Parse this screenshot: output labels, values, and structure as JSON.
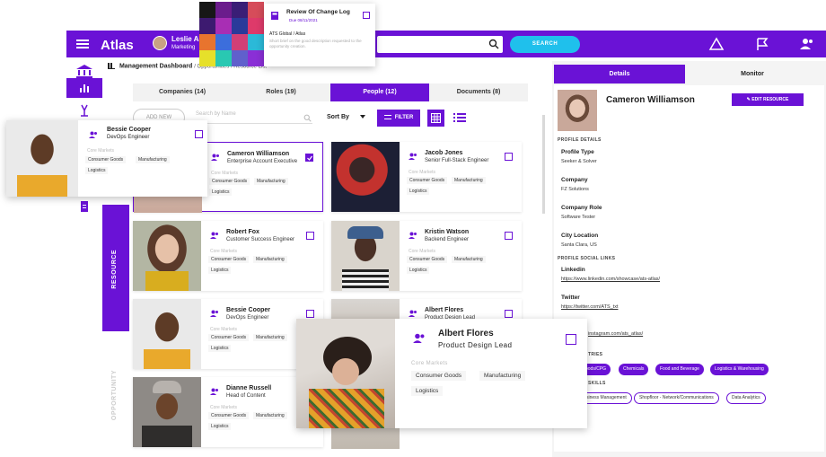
{
  "app": {
    "logo": "Atlas"
  },
  "user": {
    "name": "Leslie Ale",
    "role": "Marketing"
  },
  "search": {
    "button": "SEARCH"
  },
  "breadcrumb": {
    "title": "Management Dashboard",
    "rest": "/ Opportunities / Resource List"
  },
  "tabs": [
    {
      "label": "Companies (14)"
    },
    {
      "label": "Roles (19)"
    },
    {
      "label": "People (12)"
    },
    {
      "label": "Documents (8)"
    }
  ],
  "toolbar": {
    "add_new": "ADD NEW",
    "search_placeholder": "Search by Name",
    "sort_by": "Sort By",
    "filter": "FILTER"
  },
  "side_labels": {
    "resource": "RESOURCE",
    "opportunity": "OPPORTUNITY"
  },
  "core_markets_label": "Core Markets",
  "cards": [
    {
      "name": "Cameron Williamson",
      "title": "Enterprise Account Executive",
      "chips": [
        "Consumer Goods",
        "Manufacturing",
        "Logistics"
      ]
    },
    {
      "name": "Jacob Jones",
      "title": "Senior Full-Stack Engineer",
      "chips": [
        "Consumer Goods",
        "Manufacturing",
        "Logistics"
      ]
    },
    {
      "name": "Robert Fox",
      "title": "Customer Success Engineer",
      "chips": [
        "Consumer Goods",
        "Manufacturing",
        "Logistics"
      ]
    },
    {
      "name": "Kristin Watson",
      "title": "Backend Engineer",
      "chips": [
        "Consumer Goods",
        "Manufacturing",
        "Logistics"
      ]
    },
    {
      "name": "Bessie Cooper",
      "title": "DevOps Engineer",
      "chips": [
        "Consumer Goods",
        "Manufacturing",
        "Logistics"
      ]
    },
    {
      "name": "Albert Flores",
      "title": "Product Design Lead",
      "chips": [
        "Consumer Goods",
        "Manufacturing",
        "Logistics"
      ]
    },
    {
      "name": "Dianne Russell",
      "title": "Head of Content",
      "chips": [
        "Consumer Goods",
        "Manufacturing",
        "Logistics"
      ]
    }
  ],
  "details": {
    "tab_details": "Details",
    "tab_monitor": "Monitor",
    "name": "Cameron Williamson",
    "edit": "EDIT RESOURCE",
    "profile_details": "PROFILE DETAILS",
    "fields": [
      {
        "label": "Profile Type",
        "value": "Seeker & Solver"
      },
      {
        "label": "Company",
        "value": "FZ Solutions"
      },
      {
        "label": "Company Role",
        "value": "Software Tester"
      },
      {
        "label": "City Location",
        "value": "Santa Clara, US"
      }
    ],
    "social_title": "PROFILE SOCIAL LINKS",
    "linkedin_label": "Linkedin",
    "linkedin": "https://www.linkedin.com/showcase/ats-atlas/",
    "twitter_label": "Twitter",
    "twitter": "https://twitter.com/ATS_txt",
    "instagram": "instagram.com/ats_atlas/",
    "industries_title": "TRIES",
    "industries": [
      "oods/CPG",
      "Chemicals",
      "Food and Beverage",
      "Logistics & Warehousing"
    ],
    "skills_title": "SKILLS",
    "skills": [
      "siness Management",
      "Shopfloor - Network/Communications",
      "Data Analytics"
    ]
  },
  "changelog": {
    "title": "Review Of Change Log",
    "due": "Due 08/11/2021",
    "org": "ATS Global / Atlas",
    "desc": "Short brief on the good description requested to the opportunity creation."
  },
  "overlay_bessie": {
    "name": "Bessie Cooper",
    "title": "DevOps Engineer",
    "label": "Core Markets",
    "chips": [
      "Consumer Goods",
      "Manufacturing",
      "Logistics"
    ]
  },
  "overlay_albert": {
    "name": "Albert Flores",
    "title": "Product Design Lead",
    "label": "Core Markets",
    "chips": [
      "Consumer Goods",
      "Manufacturing",
      "Logistics"
    ]
  },
  "colors": {
    "accent": "#6a12d6",
    "search": "#1fc0ec"
  },
  "swatches": [
    "#171717",
    "#6b1c8c",
    "#3a1e76",
    "#d64c5a",
    "#3d1a70",
    "#a82eb4",
    "#2a3a9a",
    "#de3a6a",
    "#e8742e",
    "#3c6edc",
    "#d23f76",
    "#2bb9d8",
    "#e6e02a",
    "#29c8b2",
    "#6060cc",
    "#8a2fd6"
  ]
}
